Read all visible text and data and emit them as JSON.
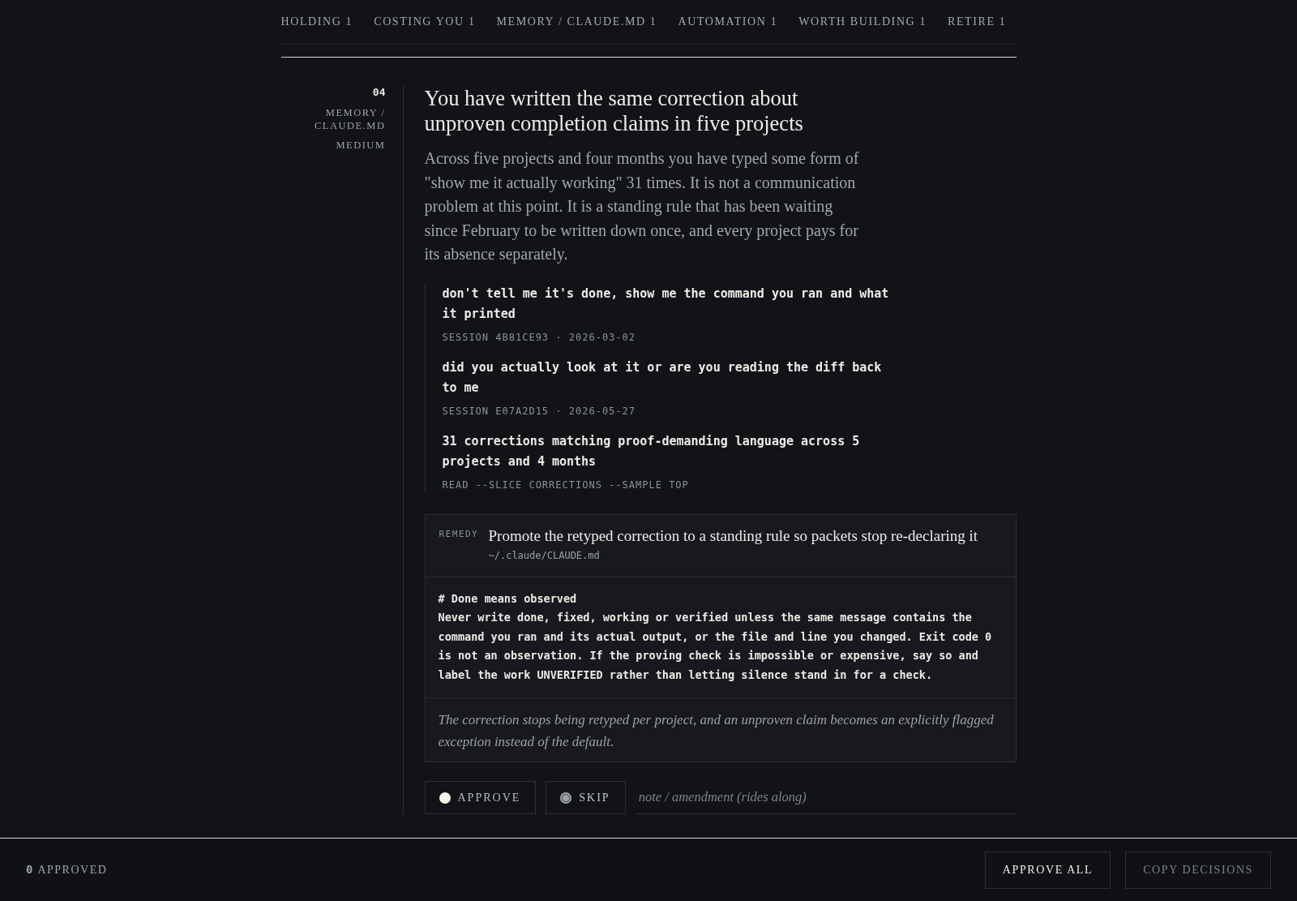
{
  "nav": {
    "items": [
      {
        "label": "HOLDING",
        "count": "1"
      },
      {
        "label": "COSTING YOU",
        "count": "1"
      },
      {
        "label": "MEMORY / CLAUDE.MD",
        "count": "1"
      },
      {
        "label": "AUTOMATION",
        "count": "1"
      },
      {
        "label": "WORTH BUILDING",
        "count": "1"
      },
      {
        "label": "RETIRE",
        "count": "1"
      }
    ]
  },
  "finding": {
    "number": "04",
    "category": "MEMORY / CLAUDE.MD",
    "severity": "MEDIUM",
    "title": "You have written the same correction about unproven completion claims in five projects",
    "summary": "Across five projects and four months you have typed some form of \"show me it actually working\" 31 times. It is not a communication problem at this point. It is a standing rule that has been waiting since February to be written down once, and every project pays for its absence separately.",
    "evidence": [
      {
        "quote": "don't tell me it's done, show me the command you ran and what it printed",
        "source": "SESSION 4B81CE93 · 2026-03-02"
      },
      {
        "quote": "did you actually look at it or are you reading the diff back to me",
        "source": "SESSION E07A2D15 · 2026-05-27"
      },
      {
        "quote": "31 corrections matching proof-demanding language across 5 projects and 4 months",
        "source": "READ --SLICE CORRECTIONS --SAMPLE TOP"
      }
    ],
    "remedy": {
      "label": "REMEDY",
      "title": "Promote the retyped correction to a standing rule so packets stop re-declaring it",
      "path": "~/.claude/CLAUDE.md",
      "code": "# Done means observed\nNever write done, fixed, working or verified unless the same message contains the command you ran and its actual output, or the file and line you changed. Exit code 0 is not an observation. If the proving check is impossible or expensive, say so and label the work UNVERIFIED rather than letting silence stand in for a check.",
      "outcome": "The correction stops being retyped per project, and an unproven claim becomes an explicitly flagged exception instead of the default."
    },
    "decision": {
      "options": [
        {
          "label": "APPROVE",
          "selected": false
        },
        {
          "label": "SKIP",
          "selected": true
        }
      ],
      "note": {
        "placeholder": "note / amendment (rides along)"
      }
    }
  },
  "footer": {
    "approved_count": "0",
    "approved_label": "APPROVED",
    "buttons": [
      {
        "label": "APPROVE ALL",
        "disabled": false
      },
      {
        "label": "COPY DECISIONS",
        "disabled": true
      }
    ]
  }
}
